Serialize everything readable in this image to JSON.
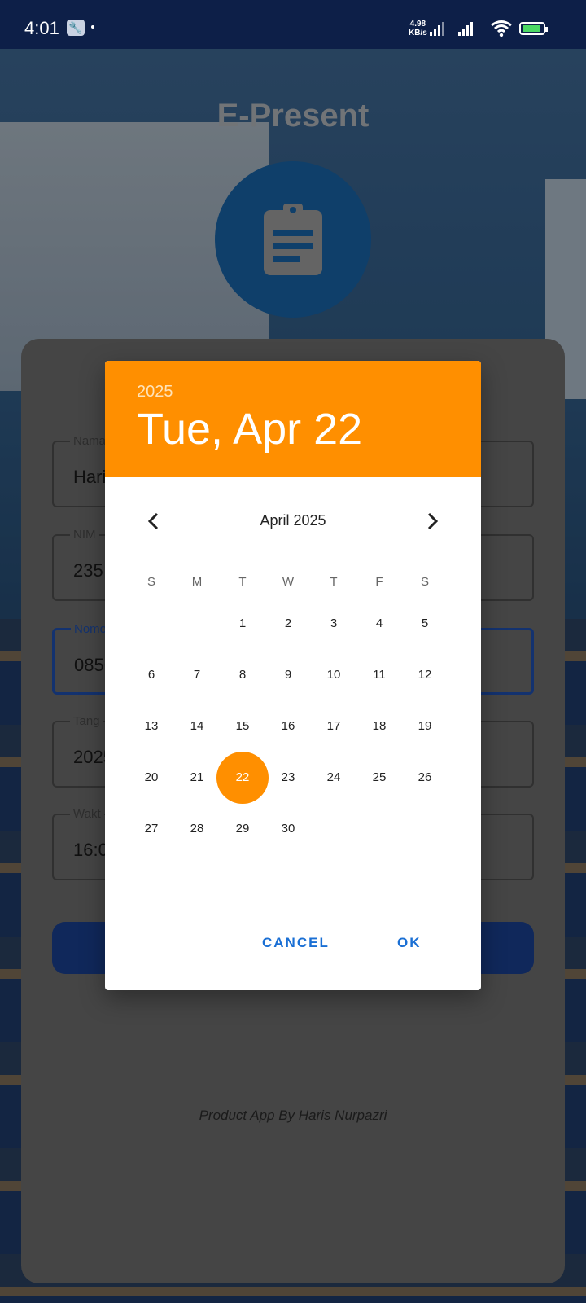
{
  "status_bar": {
    "time": "4:01",
    "speed_value": "4.98",
    "speed_unit": "KB/s"
  },
  "app": {
    "title": "E-Present",
    "footer": "Product App By Haris Nurpazri"
  },
  "form": {
    "fields": [
      {
        "label": "Nama",
        "value": "Hari"
      },
      {
        "label": "NIM",
        "value": "235"
      },
      {
        "label": "Nomo",
        "value": "0856"
      },
      {
        "label": "Tang",
        "value": "2025"
      },
      {
        "label": "Wakt",
        "value": "16:0"
      }
    ]
  },
  "date_picker": {
    "year": "2025",
    "selected_date": "Tue, Apr 22",
    "month_label": "April 2025",
    "weekdays": [
      "S",
      "M",
      "T",
      "W",
      "T",
      "F",
      "S"
    ],
    "selected_day": "22",
    "cancel_label": "CANCEL",
    "ok_label": "OK",
    "accent_color": "#ff8f00"
  },
  "colors": {
    "button_text": "#1a6fd4",
    "primary_button": "#1a3e8c"
  }
}
